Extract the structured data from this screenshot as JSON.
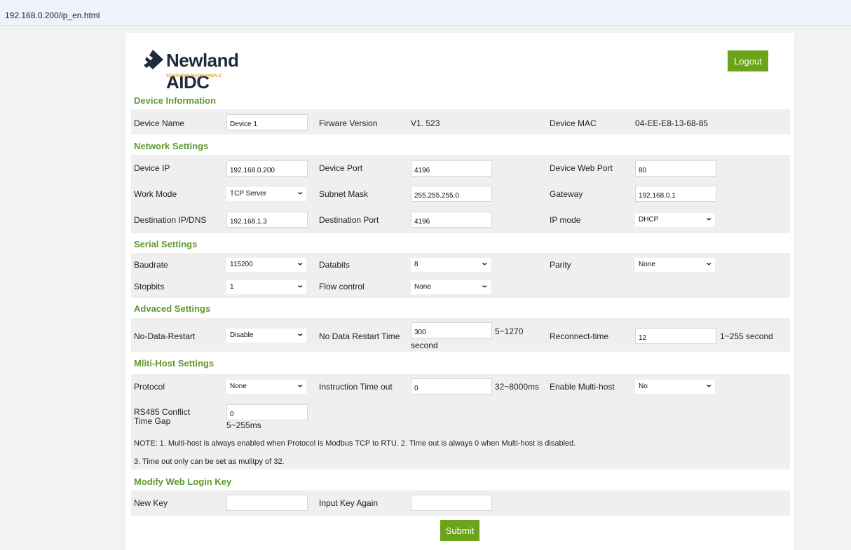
{
  "browser": {
    "url": "192.168.0.200/ip_en.html"
  },
  "header": {
    "logo_text": "Newland AIDC",
    "logo_tagline": "SCANNING MADE SIMPLE",
    "logout_label": "Logout"
  },
  "device_info": {
    "title": "Device Information",
    "name_label": "Device Name",
    "name_value": "Device 1",
    "fw_label": "Firware Version",
    "fw_value": "V1. 523",
    "mac_label": "Device MAC",
    "mac_value": "04-EE-E8-13-68-85"
  },
  "network": {
    "title": "Network Settings",
    "ip_label": "Device IP",
    "ip_value": "192.168.0.200",
    "port_label": "Device Port",
    "port_value": "4196",
    "webport_label": "Device Web Port",
    "webport_value": "80",
    "workmode_label": "Work Mode",
    "workmode_value": "TCP Server",
    "subnet_label": "Subnet Mask",
    "subnet_value": "255.255.255.0",
    "gateway_label": "Gateway",
    "gateway_value": "192.168.0.1",
    "destip_label": "Destination IP/DNS",
    "destip_value": "192.168.1.3",
    "destport_label": "Destination Port",
    "destport_value": "4196",
    "ipmode_label": "IP mode",
    "ipmode_value": "DHCP"
  },
  "serial": {
    "title": "Serial Settings",
    "baud_label": "Baudrate",
    "baud_value": "115200",
    "databits_label": "Databits",
    "databits_value": "8",
    "parity_label": "Parity",
    "parity_value": "None",
    "stopbits_label": "Stopbits",
    "stopbits_value": "1",
    "flow_label": "Flow control",
    "flow_value": "None"
  },
  "advanced": {
    "title": "Advaced Settings",
    "ndr_label": "No-Data-Restart",
    "ndr_value": "Disable",
    "ndrt_label": "No Data Restart Time",
    "ndrt_value": "300",
    "ndrt_range": "5~1270",
    "ndrt_unit": "second",
    "reconnect_label": "Reconnect-time",
    "reconnect_value": "12",
    "reconnect_range": "1~255 second"
  },
  "multihost": {
    "title": "Mliti-Host Settings",
    "protocol_label": "Protocol",
    "protocol_value": "None",
    "timeout_label": "Instruction Time out",
    "timeout_value": "0",
    "timeout_range": "32~8000ms",
    "enable_label": "Enable Multi-host",
    "enable_value": "No",
    "rs485_label": "RS485 Conflict Time Gap",
    "rs485_value": "0",
    "rs485_range": "5~255ms",
    "note1": "NOTE: 1. Multi-host is always enabled when Protocol is Modbus TCP to RTU. 2. Time out is always 0 when Multi-host is disabled.",
    "note2": "3. Time out only can be set as mulitpy of 32."
  },
  "login_key": {
    "title": "Modify Web Login Key",
    "newkey_label": "New Key",
    "newkey_value": "",
    "again_label": "Input Key Again",
    "again_value": ""
  },
  "submit_label": "Submit"
}
